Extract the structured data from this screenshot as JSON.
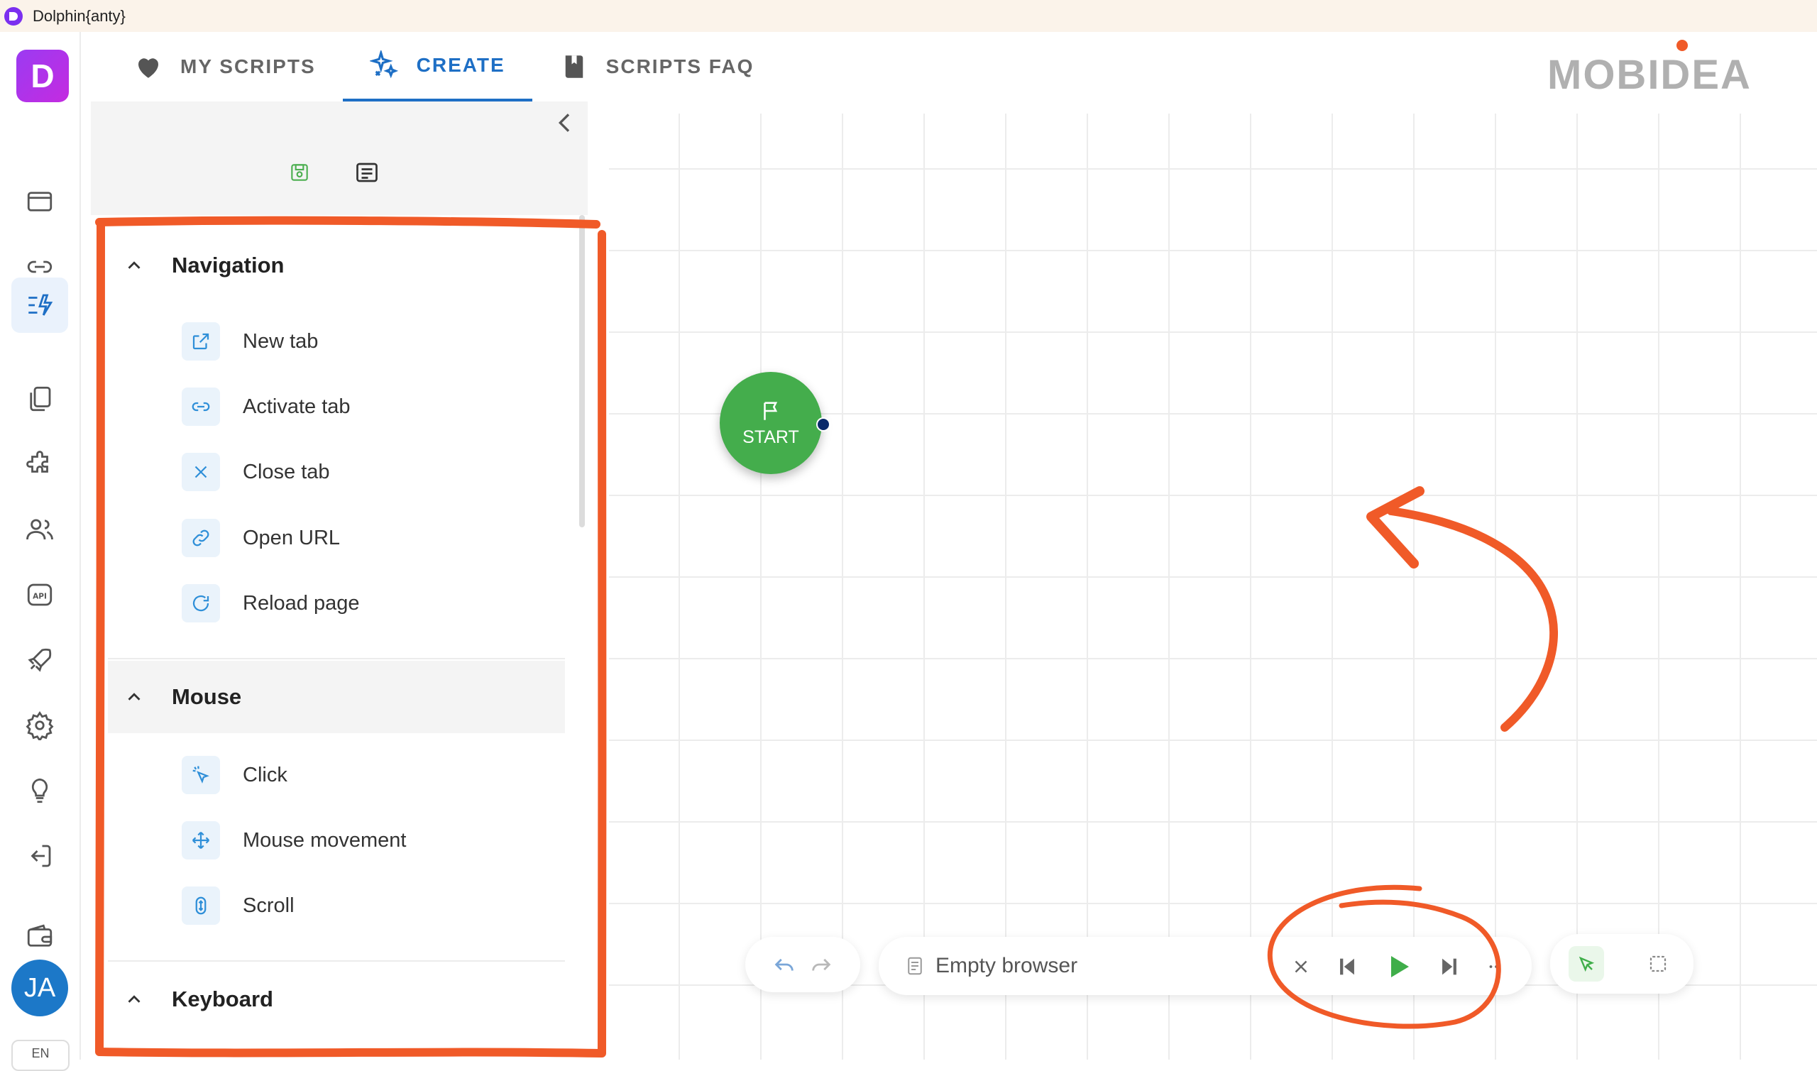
{
  "window": {
    "title": "Dolphin{anty}"
  },
  "brand": {
    "logo_letter": "D",
    "partner_logo": "MOBIDEA"
  },
  "tabs": [
    {
      "label": "MY SCRIPTS",
      "icon": "heart-icon"
    },
    {
      "label": "CREATE",
      "icon": "sparkles-icon",
      "active": true
    },
    {
      "label": "SCRIPTS FAQ",
      "icon": "book-icon"
    }
  ],
  "rail": {
    "icons": [
      "browser-window-icon",
      "link-icon",
      "scenario-icon",
      "copy-icon",
      "puzzle-icon",
      "users-icon",
      "api-icon",
      "rocket-icon",
      "settings-icon",
      "lightbulb-icon",
      "logout-icon",
      "wallet-icon"
    ],
    "avatar_initials": "JA",
    "language": "EN"
  },
  "sections": {
    "navigation": {
      "title": "Navigation",
      "items": [
        {
          "label": "New tab",
          "icon": "new-tab-icon"
        },
        {
          "label": "Activate tab",
          "icon": "link-icon"
        },
        {
          "label": "Close tab",
          "icon": "close-icon"
        },
        {
          "label": "Open URL",
          "icon": "chain-icon"
        },
        {
          "label": "Reload page",
          "icon": "reload-icon"
        }
      ]
    },
    "mouse": {
      "title": "Mouse",
      "items": [
        {
          "label": "Click",
          "icon": "cursor-click-icon"
        },
        {
          "label": "Mouse movement",
          "icon": "move-icon"
        },
        {
          "label": "Scroll",
          "icon": "scroll-icon"
        }
      ]
    },
    "keyboard": {
      "title": "Keyboard"
    }
  },
  "canvas": {
    "start_label": "START"
  },
  "player": {
    "browser_label": "Empty browser"
  },
  "colors": {
    "accent": "#1e6fc5",
    "start_green": "#44ad4c",
    "annotation": "#f05a28"
  }
}
